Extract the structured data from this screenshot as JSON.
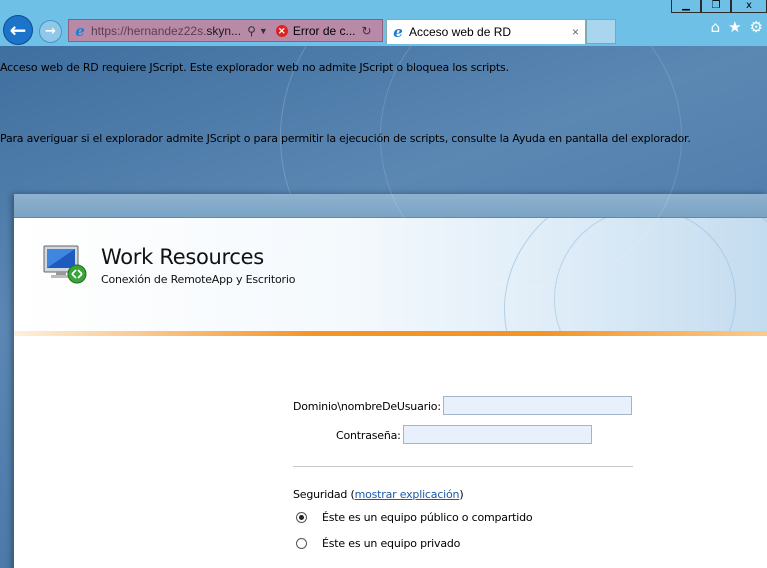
{
  "browser": {
    "url_prefix": "https://hernandez22s.",
    "url_host": "skyn...",
    "error_tab_label": "Error de c...",
    "active_tab_title": "Acceso web de RD",
    "tab_close": "×",
    "window_buttons": {
      "minimize": "▁",
      "restore": "❐",
      "close": "x"
    },
    "icons": {
      "home": "home-icon",
      "favorites": "star-icon",
      "tools": "gear-icon"
    }
  },
  "page": {
    "notice_1": "Acceso web de RD requiere JScript. Este explorador web no admite JScript o bloquea los scripts.",
    "notice_2": "Para averiguar si el explorador admite JScript o para permitir la ejecución de scripts, consulte la Ayuda en pantalla del explorador."
  },
  "header": {
    "title": "Work Resources",
    "subtitle": "Conexión de RemoteApp y Escritorio"
  },
  "login": {
    "username_label": "Dominio\\nombreDeUsuario:",
    "username_value": "",
    "password_label": "Contraseña:",
    "password_value": "",
    "security_label": "Seguridad (",
    "security_link": "mostrar explicación",
    "security_close": ")",
    "options": [
      {
        "label": "Éste es un equipo público o compartido",
        "selected": true
      },
      {
        "label": "Éste es un equipo privado",
        "selected": false
      }
    ]
  }
}
